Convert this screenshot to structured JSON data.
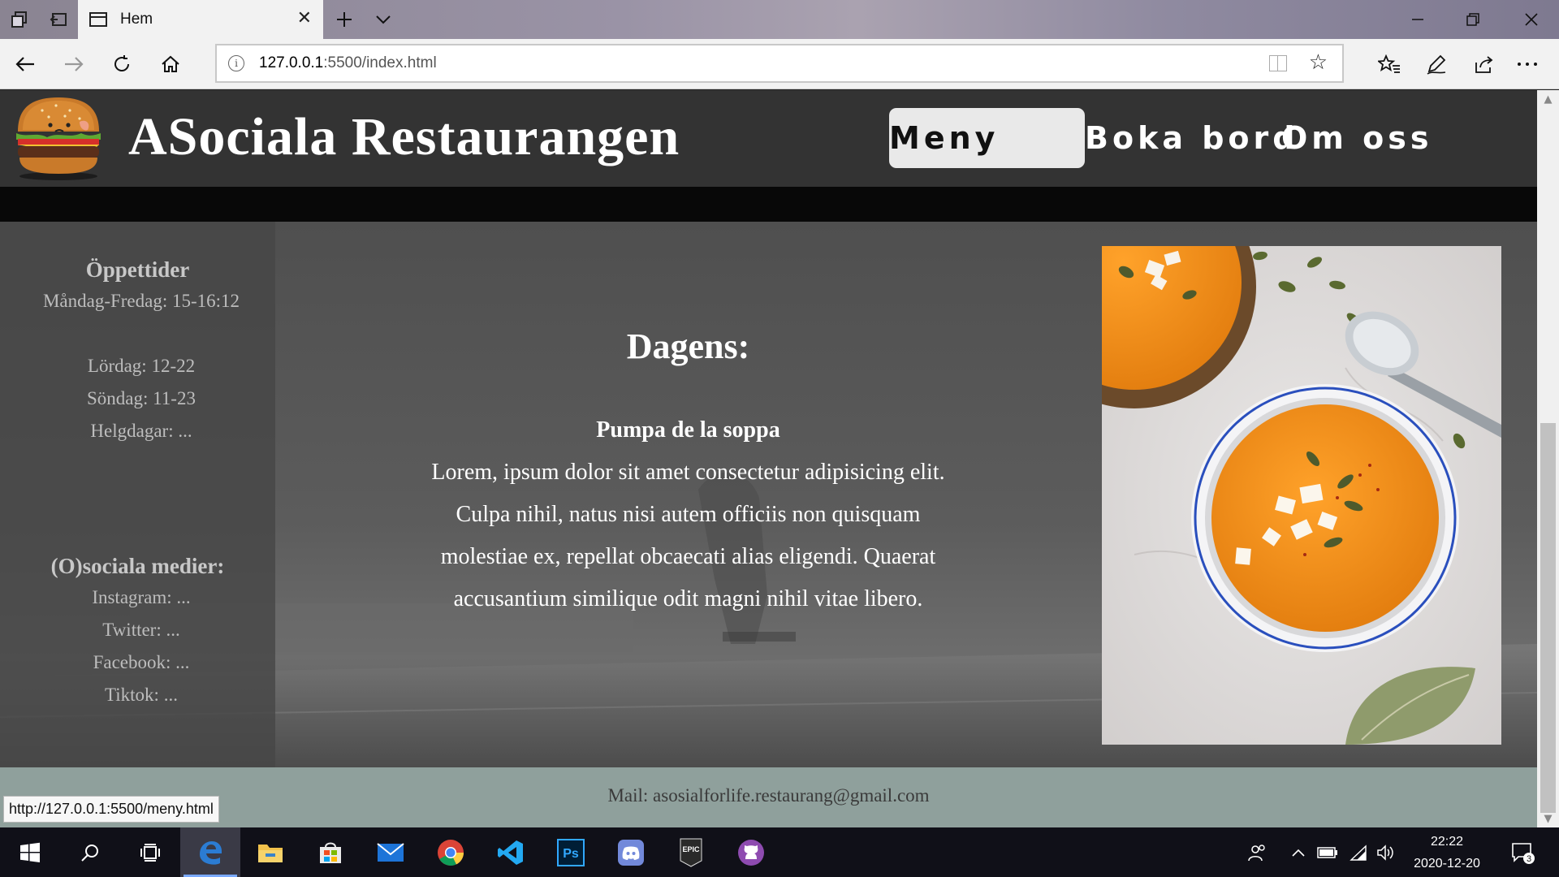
{
  "browser": {
    "tab_title": "Hem",
    "url_host": "127.0.0.1",
    "url_path": ":5500/index.html",
    "status_url": "http://127.0.0.1:5500/meny.html",
    "icons": [
      "tab-manager-icon",
      "set-aside-tabs-icon",
      "page-icon",
      "close-icon",
      "new-tab-icon",
      "chevron-down-icon",
      "minimize-icon",
      "restore-icon",
      "close-window-icon",
      "back-icon",
      "forward-icon",
      "refresh-icon",
      "home-icon",
      "info-icon",
      "reading-view-icon",
      "favorite-star-icon",
      "favorites-list-icon",
      "pen-icon",
      "share-icon",
      "more-icon"
    ]
  },
  "site": {
    "title": "ASociala Restaurangen",
    "nav": {
      "meny": "Meny",
      "boka": "Boka bord",
      "om": "Om oss"
    },
    "sidebar": {
      "hours_heading": "Öppettider",
      "hours": [
        "Måndag-Fredag: 15-16:12",
        "Lördag: 12-22",
        "Söndag: 11-23",
        "Helgdagar: ..."
      ],
      "social_heading": "(O)sociala medier:",
      "social": [
        "Instagram: ...",
        "Twitter: ...",
        "Facebook: ...",
        "Tiktok: ..."
      ]
    },
    "dagens": {
      "title": "Dagens:",
      "dish": "Pumpa de la soppa",
      "description": "Lorem, ipsum dolor sit amet consectetur adipisicing elit. Culpa nihil, natus nisi autem officiis non quisquam molestiae ex, repellat obcaecati alias eligendi. Quaerat accusantium similique odit magni nihil vitae libero."
    },
    "footer": {
      "mail": "Mail: asosialforlife.restaurang@gmail.com"
    },
    "colors": {
      "header_bg": "#333333",
      "menu_active_bg": "#e9e9e9",
      "footer_bg": "#8fa09c",
      "soup_orange": "#f29418"
    }
  },
  "taskbar": {
    "apps": [
      "windows-start-icon",
      "search-icon",
      "task-view-icon",
      "edge-icon",
      "file-explorer-icon",
      "store-icon",
      "mail-icon",
      "chrome-icon",
      "vscode-icon",
      "photoshop-icon",
      "discord-icon",
      "epic-games-icon",
      "github-icon"
    ],
    "epic_label": "EPIC",
    "ps_label": "Ps",
    "time": "22:22",
    "date": "2020-12-20",
    "notification_count": "3"
  }
}
